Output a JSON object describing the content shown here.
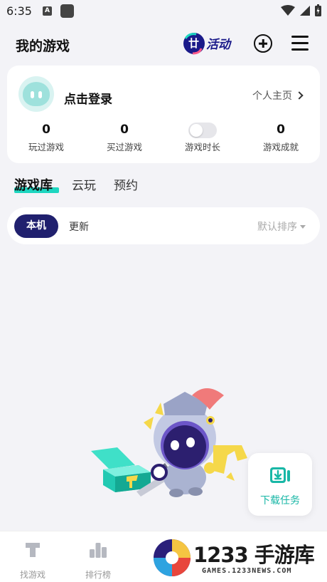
{
  "status_bar": {
    "time": "6:35",
    "a_icon": "A"
  },
  "header": {
    "title": "我的游戏",
    "activity_badge": "活动",
    "activity_badge_prefix": "廿"
  },
  "profile": {
    "login": "点击登录",
    "homepage": "个人主页",
    "stats": [
      {
        "value": "0",
        "label": "玩过游戏"
      },
      {
        "value": "0",
        "label": "买过游戏"
      },
      {
        "value": "",
        "label": "游戏时长"
      },
      {
        "value": "0",
        "label": "游戏成就"
      }
    ]
  },
  "tabs": [
    {
      "label": "游戏库",
      "active": true
    },
    {
      "label": "云玩",
      "active": false
    },
    {
      "label": "预约",
      "active": false
    }
  ],
  "filter": {
    "local": "本机",
    "update": "更新",
    "sort": "默认排序"
  },
  "download_float": {
    "label": "下载任务"
  },
  "bottom_nav": [
    {
      "label": "找游戏",
      "icon": "find-game-icon"
    },
    {
      "label": "排行榜",
      "icon": "ranking-icon"
    }
  ],
  "watermark": {
    "text": "1233 手游库",
    "sub": "GAMES.1233NEWS.COM"
  },
  "colors": {
    "accent": "#1ed6c0",
    "primary": "#20206e",
    "download": "#18b7a6"
  }
}
